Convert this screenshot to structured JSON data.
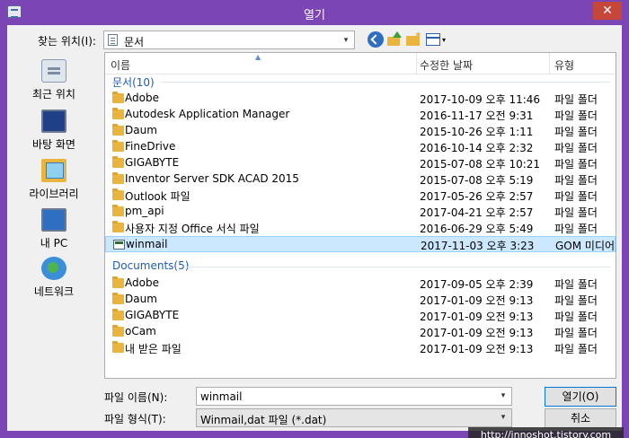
{
  "window": {
    "title": "열기",
    "close_glyph": "✕"
  },
  "lookin": {
    "label": "찾는 위치(I):",
    "value": "문서"
  },
  "toolbar": {
    "back_icon": "back-arrow-icon",
    "up_icon": "up-folder-icon",
    "new_icon": "new-folder-icon",
    "view_icon": "view-menu-icon",
    "view_caret": "▾"
  },
  "places": [
    {
      "label": "최근 위치",
      "icon": "recent-places-icon"
    },
    {
      "label": "바탕 화면",
      "icon": "desktop-icon"
    },
    {
      "label": "라이브러리",
      "icon": "library-icon"
    },
    {
      "label": "내 PC",
      "icon": "pc-icon"
    },
    {
      "label": "네트워크",
      "icon": "network-icon"
    }
  ],
  "columns": {
    "name": "이름",
    "date": "수정한 날짜",
    "type": "유형",
    "sort_glyph": "▲"
  },
  "groups": [
    {
      "title": "문서(10)",
      "rows": [
        {
          "name": "Adobe",
          "date": "2017-10-09 오후 11:46",
          "type": "파일 폴더",
          "kind": "folder"
        },
        {
          "name": "Autodesk Application Manager",
          "date": "2016-11-17 오전 9:31",
          "type": "파일 폴더",
          "kind": "folder"
        },
        {
          "name": "Daum",
          "date": "2015-10-26 오후 1:11",
          "type": "파일 폴더",
          "kind": "folder"
        },
        {
          "name": "FineDrive",
          "date": "2016-10-14 오후 2:32",
          "type": "파일 폴더",
          "kind": "folder"
        },
        {
          "name": "GIGABYTE",
          "date": "2015-07-08 오후 10:21",
          "type": "파일 폴더",
          "kind": "folder"
        },
        {
          "name": "Inventor Server SDK ACAD 2015",
          "date": "2015-07-08 오후 5:19",
          "type": "파일 폴더",
          "kind": "folder"
        },
        {
          "name": "Outlook 파일",
          "date": "2017-05-26 오후 2:57",
          "type": "파일 폴더",
          "kind": "folder"
        },
        {
          "name": "pm_api",
          "date": "2017-04-21 오후 2:57",
          "type": "파일 폴더",
          "kind": "folder"
        },
        {
          "name": "사용자 지정 Office 서식 파일",
          "date": "2016-06-29 오후 5:49",
          "type": "파일 폴더",
          "kind": "folder"
        },
        {
          "name": "winmail",
          "date": "2017-11-03 오후 3:23",
          "type": "GOM 미디어",
          "kind": "dat",
          "selected": true
        }
      ]
    },
    {
      "title": "Documents(5)",
      "rows": [
        {
          "name": "Adobe",
          "date": "2017-09-05 오후 2:39",
          "type": "파일 폴더",
          "kind": "folder"
        },
        {
          "name": "Daum",
          "date": "2017-01-09 오전 9:13",
          "type": "파일 폴더",
          "kind": "folder"
        },
        {
          "name": "GIGABYTE",
          "date": "2017-01-09 오전 9:13",
          "type": "파일 폴더",
          "kind": "folder"
        },
        {
          "name": "oCam",
          "date": "2017-01-09 오전 9:13",
          "type": "파일 폴더",
          "kind": "folder"
        },
        {
          "name": "내 받은 파일",
          "date": "2017-01-09 오전 9:13",
          "type": "파일 폴더",
          "kind": "folder"
        }
      ]
    }
  ],
  "scrollbar": {
    "left_glyph": "◀",
    "right_glyph": "▶"
  },
  "filename": {
    "label": "파일 이름(N):",
    "value": "winmail",
    "arrow": "▾"
  },
  "filetype": {
    "label": "파일 형식(T):",
    "value": "Winmail,dat 파일 (*.dat)",
    "arrow": "▾"
  },
  "buttons": {
    "open": "열기(O)",
    "cancel": "취소"
  },
  "watermark": "http://innoshot.tistory.com"
}
